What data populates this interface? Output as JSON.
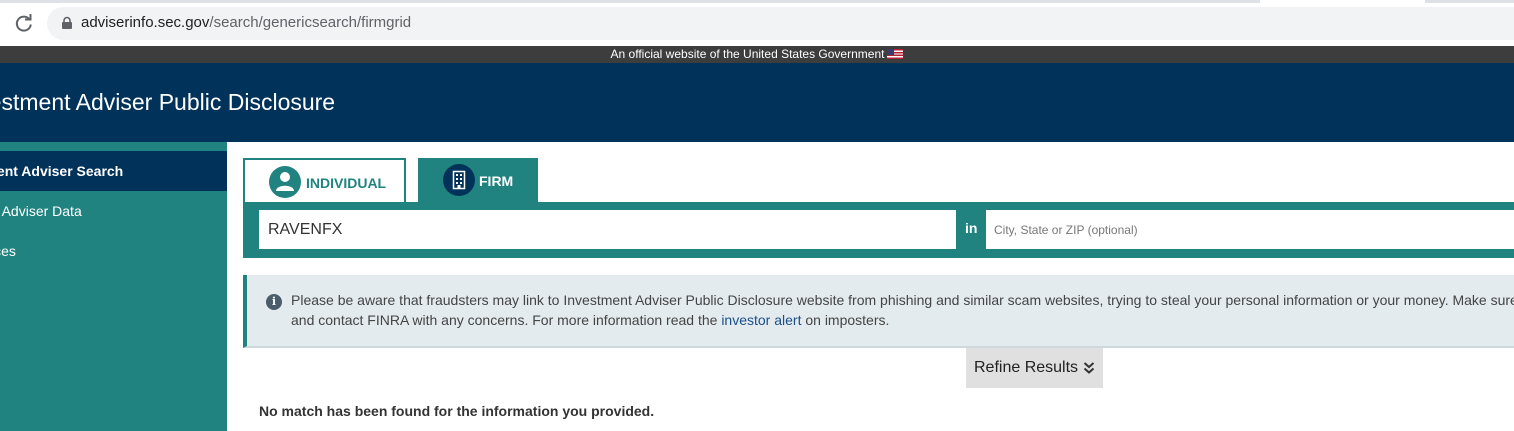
{
  "browser": {
    "url_domain": "adviserinfo.sec.gov",
    "url_path": "/search/genericsearch/firmgrid"
  },
  "gov_banner": {
    "text": "An official website of the United States Government"
  },
  "header": {
    "title": "Investment Adviser Public Disclosure"
  },
  "sidebar": {
    "items": [
      {
        "label": "Investment Adviser Search",
        "active": true
      },
      {
        "label": "Investment Adviser Data",
        "active": false
      },
      {
        "label": "Resources",
        "active": false
      }
    ]
  },
  "tabs": {
    "individual": "INDIVIDUAL",
    "firm": "FIRM"
  },
  "search": {
    "value": "RAVENFX",
    "in_label": "in",
    "location_placeholder": "City, State or ZIP (optional)"
  },
  "alert": {
    "line1": "Please be aware that fraudsters may link to Investment Adviser Public Disclosure website from phishing and similar scam websites, trying to steal your personal information or your money. Make sure you",
    "line2_before": "and contact FINRA with any concerns. For more information read the ",
    "link": "investor alert",
    "line2_after": " on imposters."
  },
  "refine": {
    "label": "Refine Results"
  },
  "results": {
    "no_match": "No match has been found for the information you provided."
  },
  "colors": {
    "navy": "#00325a",
    "teal": "#218380",
    "alert_bg": "#e4ebee"
  }
}
